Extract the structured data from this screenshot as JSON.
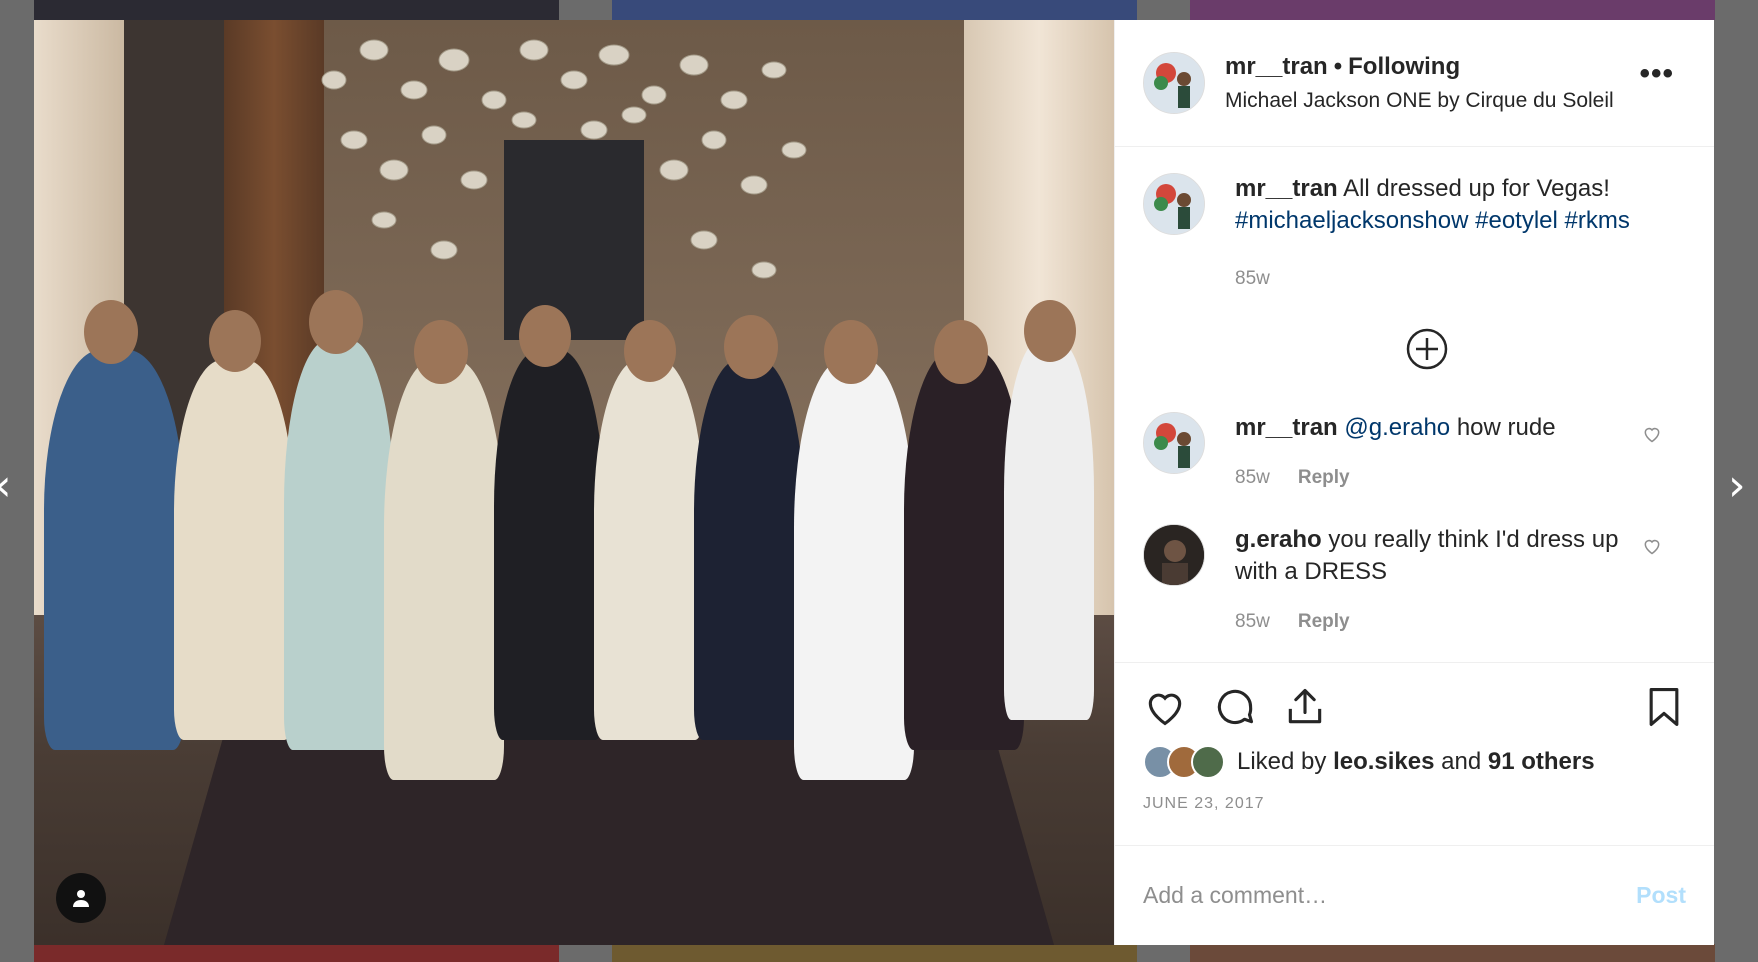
{
  "colors": {
    "link": "#00376b",
    "muted": "#8e8e8e",
    "text": "#262626",
    "post_disabled": "#b2dffc",
    "backdrop": "#6b6b6b"
  },
  "navigation": {
    "prev_glyph": "‹",
    "next_glyph": "›"
  },
  "header": {
    "username": "mr__tran",
    "separator": "•",
    "follow_status": "Following",
    "location": "Michael Jackson ONE by Cirque du Soleil",
    "more_glyph": "•••"
  },
  "caption": {
    "username": "mr__tran",
    "text": "All dressed up for Vegas!",
    "hashtags": [
      "#michaeljacksonshow",
      "#eotylel",
      "#rkms"
    ],
    "time": "85w"
  },
  "comments": [
    {
      "username": "mr__tran",
      "mention": "@g.eraho",
      "text": "how rude",
      "time": "85w",
      "reply_label": "Reply"
    },
    {
      "username": "g.eraho",
      "text": "you really think I'd dress up with a DRESS",
      "time": "85w",
      "reply_label": "Reply"
    }
  ],
  "icons": {
    "like": "heart-icon",
    "comment": "speech-bubble-icon",
    "share": "share-icon",
    "save": "bookmark-icon",
    "load_more": "plus-circle-icon",
    "user_tags": "person-icon"
  },
  "likes": {
    "prefix": "Liked by",
    "first_user": "leo.sikes",
    "conjunction": "and",
    "others": "91 others"
  },
  "date": "JUNE 23, 2017",
  "add_comment": {
    "placeholder": "Add a comment…",
    "post_label": "Post"
  }
}
